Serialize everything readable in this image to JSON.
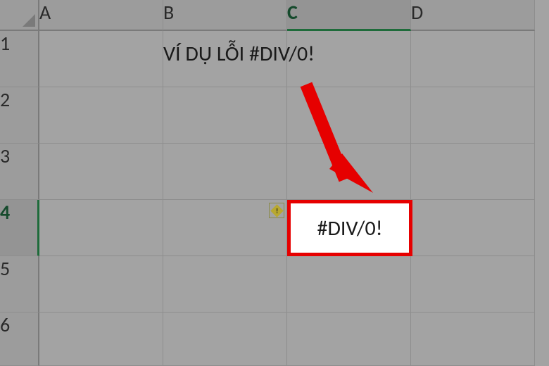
{
  "columns": [
    "A",
    "B",
    "C",
    "D"
  ],
  "rows": [
    "1",
    "2",
    "3",
    "4",
    "5",
    "6"
  ],
  "selected_column": "C",
  "selected_row": "4",
  "title_text": "VÍ DỤ LỖI #DIV/0!",
  "error_value": "#DIV/0!"
}
